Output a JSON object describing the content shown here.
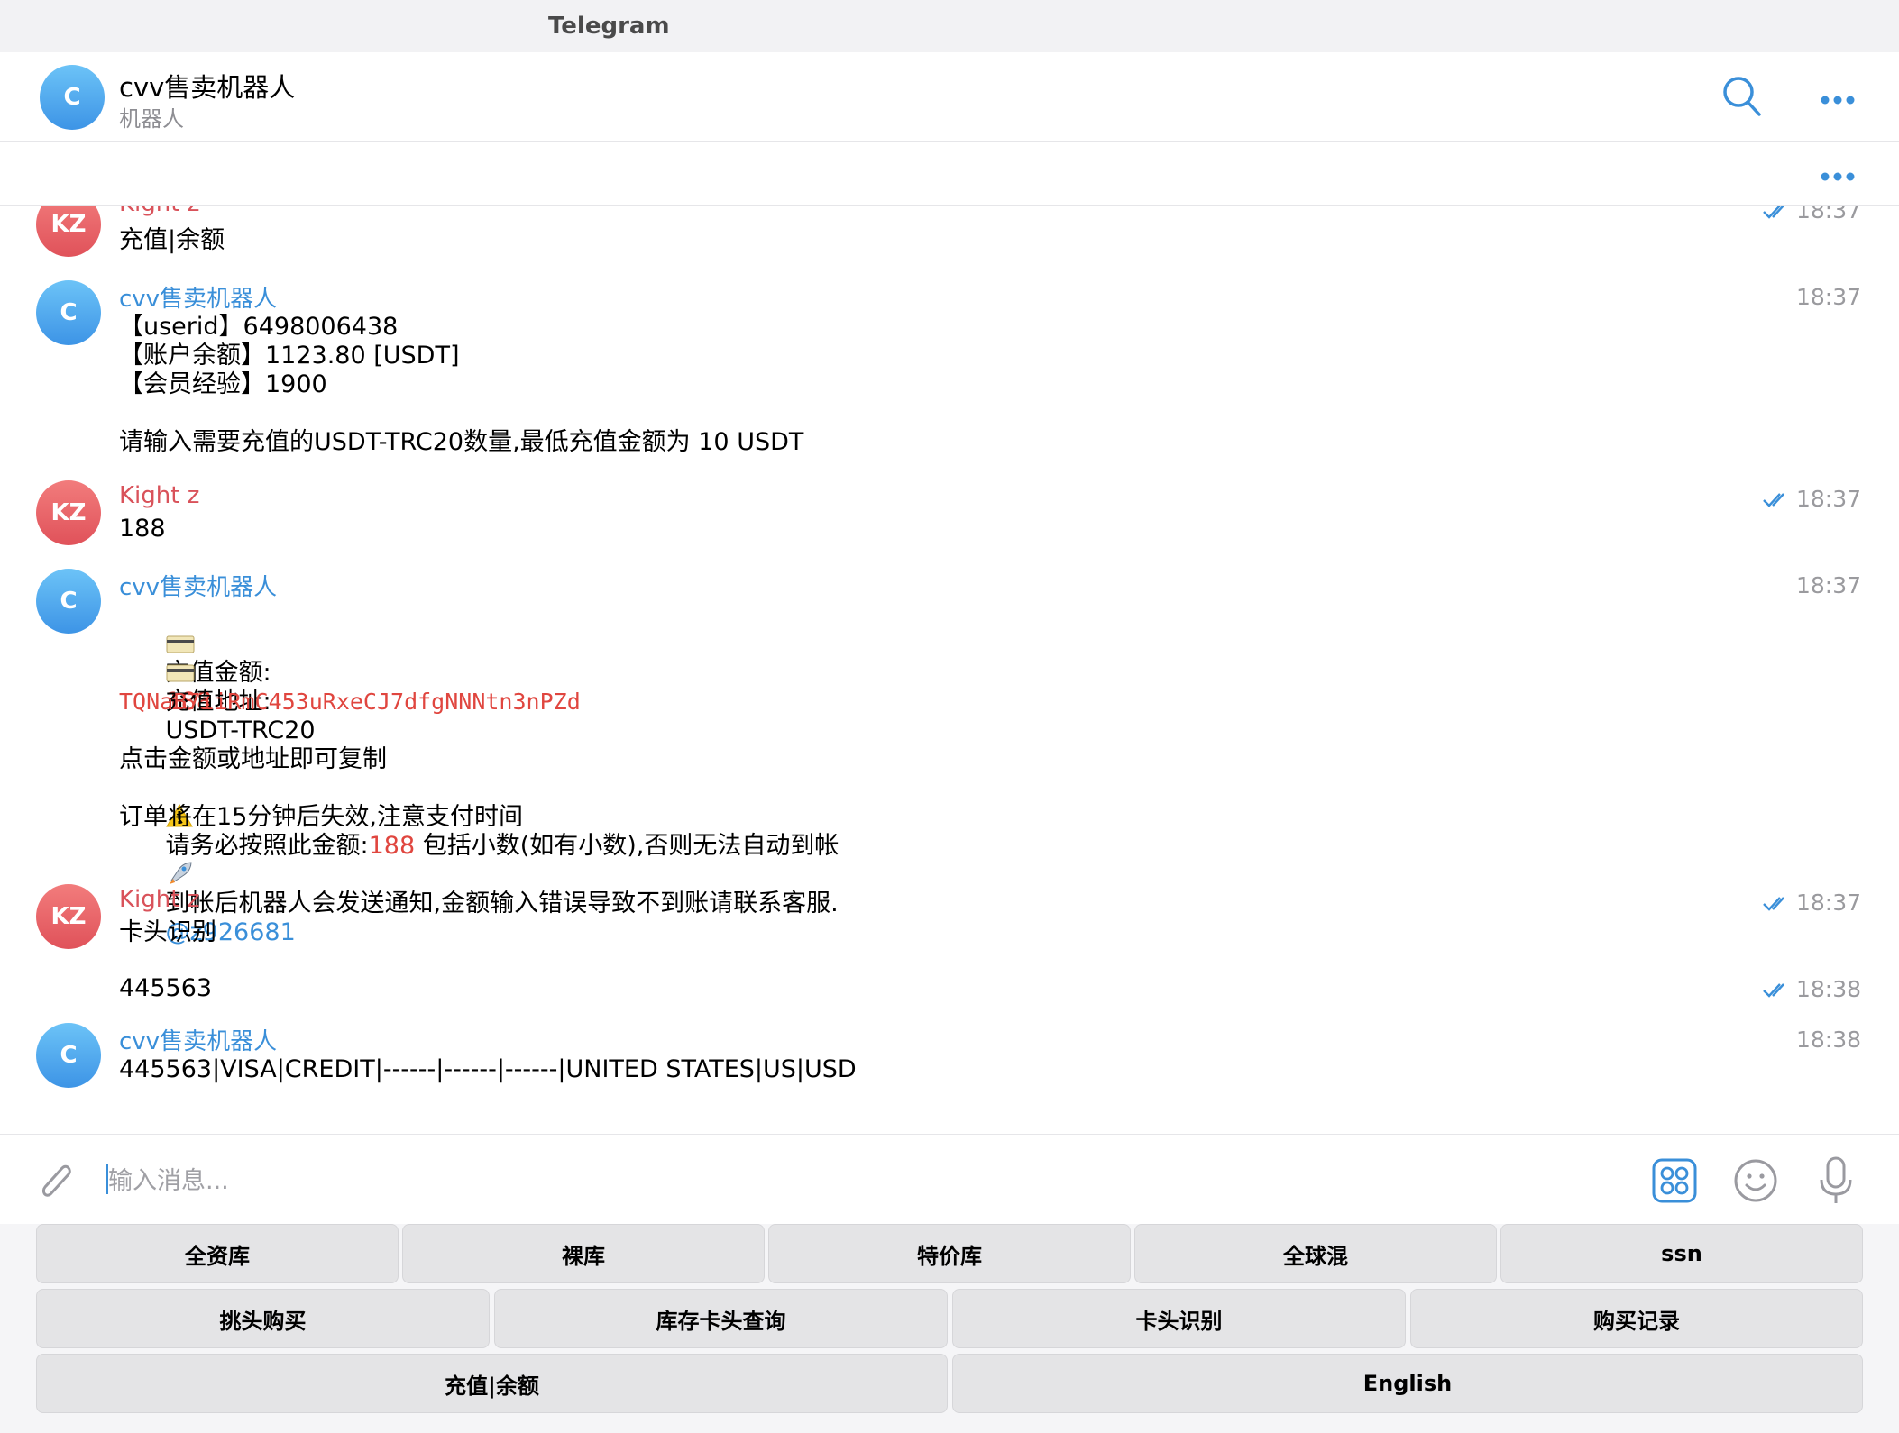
{
  "window": {
    "title": "Telegram"
  },
  "header": {
    "avatar_letter": "C",
    "chat_name": "cvv售卖机器人",
    "chat_subtitle": "机器人",
    "icons": [
      "search-icon",
      "more-icon"
    ]
  },
  "pinned": {
    "icon": "more-icon"
  },
  "messages": [
    {
      "sender": "Kight z",
      "avatar": "KZ",
      "type": "user",
      "time": "18:37",
      "read": true,
      "lines": [
        "充值|余额"
      ]
    },
    {
      "sender": "cvv售卖机器人",
      "avatar": "C",
      "type": "bot",
      "time": "18:37",
      "lines": [
        "【userid】6498006438",
        "【账户余额】1123.80 [USDT]",
        "【会员经验】1900",
        "",
        "请输入需要充值的USDT-TRC20数量,最低充值金额为 10 USDT"
      ]
    },
    {
      "sender": "Kight z",
      "avatar": "KZ",
      "type": "user",
      "time": "18:37",
      "read": true,
      "lines": [
        "188"
      ]
    },
    {
      "sender": "cvv售卖机器人",
      "avatar": "C",
      "type": "bot",
      "time": "18:37",
      "amount_label": "充值金额:",
      "amount_value": "188",
      "amount_unit": "USDT-TRC20",
      "address_label": "充值地址:",
      "address": "TQNaB7iiRmC453uRxeCJ7dfgNNNtn3nPZd",
      "copy_hint": "点击金额或地址即可复制",
      "warning_prefix": "请务必按照此金额:",
      "warning_amount": "188",
      "warning_suffix": " 包括小数(如有小数),否则无法自动到帐",
      "expiry_note": "订单将在15分钟后失效,注意支付时间",
      "notify_note": "到帐后机器人会发送通知,金额输入错误导致不到账请联系客服.",
      "contact": "@z926681"
    },
    {
      "sender": "Kight z",
      "avatar": "KZ",
      "type": "user",
      "time": "18:37",
      "read": true,
      "lines": [
        "卡头识别"
      ]
    },
    {
      "type": "user-cont",
      "time": "18:38",
      "read": true,
      "lines": [
        "445563"
      ]
    },
    {
      "sender": "cvv售卖机器人",
      "avatar": "C",
      "type": "bot",
      "time": "18:38",
      "lines": [
        "445563|VISA|CREDIT|------|------|------|UNITED STATES|US|USD"
      ]
    }
  ],
  "input": {
    "placeholder": "输入消息...",
    "value": ""
  },
  "keyboard": {
    "row1": [
      "全资库",
      "裸库",
      "特价库",
      "全球混",
      "ssn"
    ],
    "row2": [
      "挑头购买",
      "库存卡头查询",
      "卡头识别",
      "购买记录"
    ],
    "row3": [
      "充值|余额",
      "English"
    ]
  },
  "colors": {
    "accent": "#3a8fd9",
    "user_name": "#d9525a",
    "highlight": "#e0463f",
    "read_check": "#3a8fd9"
  }
}
